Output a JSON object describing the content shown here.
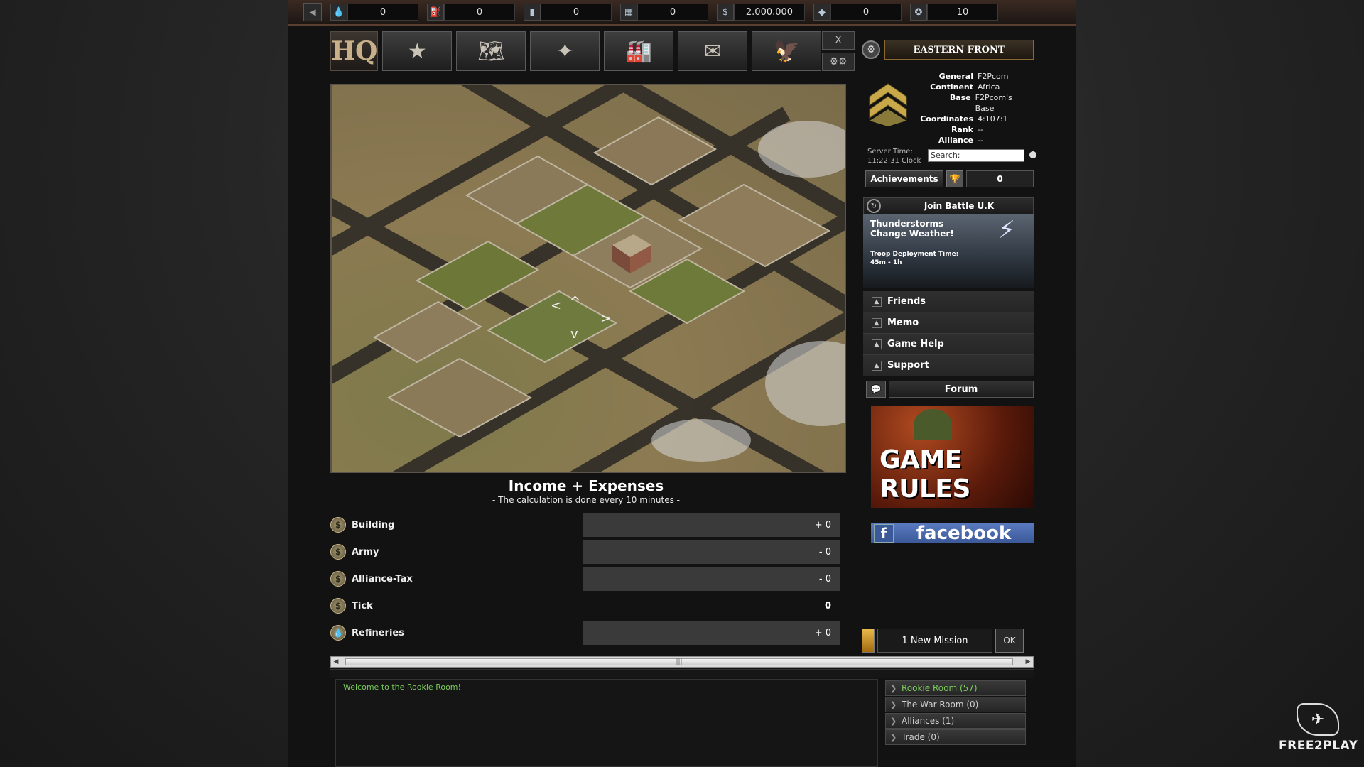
{
  "resources": [
    {
      "icon": "oil-icon",
      "glyph": "💧",
      "value": "0"
    },
    {
      "icon": "fuel-icon",
      "glyph": "⛽",
      "value": "0"
    },
    {
      "icon": "ammo-icon",
      "glyph": "▮",
      "value": "0"
    },
    {
      "icon": "steel-icon",
      "glyph": "▦",
      "value": "0"
    },
    {
      "icon": "money-icon",
      "glyph": "$",
      "value": "2.000.000"
    },
    {
      "icon": "gold-icon",
      "glyph": "◆",
      "value": "0"
    },
    {
      "icon": "medal-icon",
      "glyph": "✪",
      "value": "10"
    }
  ],
  "nav": {
    "hq_label": "HQ",
    "tabs": [
      {
        "name": "army-tab",
        "icon": "star-icon",
        "glyph": "★"
      },
      {
        "name": "map-tab",
        "icon": "map-icon",
        "glyph": "🗺"
      },
      {
        "name": "air-force-tab",
        "icon": "wings-icon",
        "glyph": "✦"
      },
      {
        "name": "buildings-tab",
        "icon": "factory-icon",
        "glyph": "🏭"
      },
      {
        "name": "messages-tab",
        "icon": "envelope-icon",
        "glyph": "✉"
      },
      {
        "name": "alliance-tab",
        "icon": "eagle-icon",
        "glyph": "🦅"
      }
    ],
    "close": "X",
    "settings": "⚙⚙"
  },
  "profile": {
    "front": "EASTERN FRONT",
    "rows": [
      {
        "k": "General",
        "v": "F2Pcom"
      },
      {
        "k": "Continent",
        "v": "Africa"
      },
      {
        "k": "Base",
        "v": "F2Pcom's Base"
      },
      {
        "k": "Coordinates",
        "v": "4:107:1"
      },
      {
        "k": "Rank",
        "v": "--"
      },
      {
        "k": "Alliance",
        "v": "--"
      }
    ],
    "server_time_label": "Server Time:",
    "server_time": "11:22:31 Clock",
    "search_placeholder": "Search:",
    "achievements_label": "Achievements",
    "achievements_count": "0"
  },
  "battle": {
    "title": "Join Battle U.K",
    "headline1": "Thunderstorms",
    "headline2": "Change Weather!",
    "deploy_label": "Troop Deployment Time:",
    "deploy_time": "45m - 1h"
  },
  "side_links": [
    "Friends",
    "Memo",
    "Game Help",
    "Support"
  ],
  "forum_label": "Forum",
  "rules_label": "GAME RULES",
  "facebook_label": "facebook",
  "mission": {
    "label": "1 New Mission",
    "ok": "OK"
  },
  "income": {
    "title": "Income + Expenses",
    "subtitle": "- The calculation is done every 10 minutes -",
    "rows": [
      {
        "label": "Building",
        "value": "+ 0",
        "icon": "coin-icon",
        "glyph": "$",
        "plain": false
      },
      {
        "label": "Army",
        "value": "- 0",
        "icon": "coin-icon",
        "glyph": "$",
        "plain": false
      },
      {
        "label": "Alliance-Tax",
        "value": "- 0",
        "icon": "coin-icon",
        "glyph": "$",
        "plain": false
      },
      {
        "label": "Tick",
        "value": "0",
        "icon": "coin-icon",
        "glyph": "$",
        "plain": true
      },
      {
        "label": "Refineries",
        "value": "+ 0",
        "icon": "oil-drop-icon",
        "glyph": "💧",
        "plain": false
      }
    ]
  },
  "chat": {
    "welcome": "Welcome to the Rookie Room!",
    "rooms": [
      {
        "label": "Rookie Room (57)",
        "active": true
      },
      {
        "label": "The War Room (0)",
        "active": false
      },
      {
        "label": "Alliances (1)",
        "active": false
      },
      {
        "label": "Trade (0)",
        "active": false
      }
    ]
  },
  "brand": "FREE2PLAY"
}
